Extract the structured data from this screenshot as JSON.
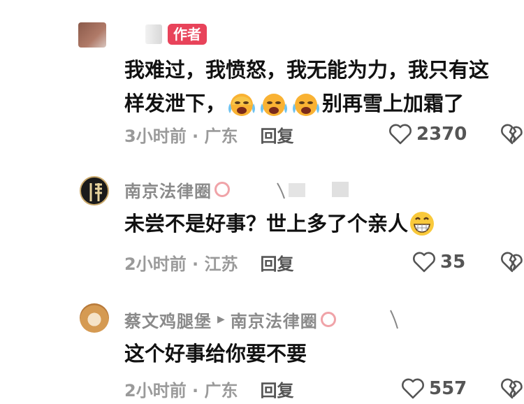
{
  "comments": [
    {
      "name": "",
      "author_badge": "作者",
      "text_line1": "我难过，我愤怒，我无能为力，我只有这",
      "text_line2": "样发泄下，",
      "text_line2_suffix": "别再雪上加霜了",
      "time_location": "3小时前 · 广东",
      "reply_label": "回复",
      "likes": "2370"
    },
    {
      "name": "南京法律圈",
      "text_line1": "未尝不是好事？世上多了个亲人",
      "time_location": "2小时前 · 江苏",
      "reply_label": "回复",
      "likes": "35"
    },
    {
      "name": "蔡文鸡腿堡",
      "reply_to": "南京法律圈",
      "text_line1": "这个好事给你要不要",
      "time_location": "2小时前 · 广东",
      "reply_label": "回复",
      "likes": "557"
    }
  ],
  "colors": {
    "author_badge": "#e8435a",
    "meta_text": "#9a9a9a",
    "name_text": "#8a8a8a"
  },
  "icons": [
    "heart-icon",
    "broken-heart-icon",
    "crying-emoji-icon",
    "grinning-emoji-icon"
  ]
}
